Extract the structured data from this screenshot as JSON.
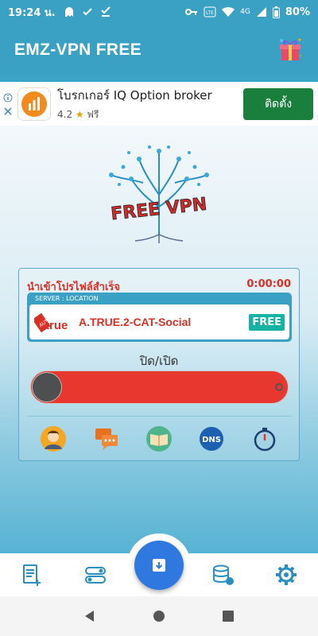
{
  "status_bar": {
    "time": "19:24 น.",
    "battery": "80%",
    "network": "4G"
  },
  "app": {
    "title": "EMZ-VPN FREE"
  },
  "ad": {
    "name": "โบรกเกอร์ IQ Option broker",
    "rating": "4.2",
    "star": "★",
    "price": "ฟรี",
    "install_label": "ติดตั้ง"
  },
  "logo": {
    "text": "FREE VPN"
  },
  "connection": {
    "status": "นำเข้าโปรไฟล์สำเร็จ",
    "timer": "0:00:00",
    "server_label": "SERVER : LOCATION",
    "server_name": "A.TRUE.2-CAT-Social",
    "badge": "FREE",
    "toggle_label": "ปิด/เปิด"
  },
  "colors": {
    "primary": "#3aa1c4",
    "danger": "#e8372e",
    "free_badge": "#14b3a3",
    "install": "#1a7f3c",
    "fab": "#2e78e0"
  },
  "tools": [
    "profile-icon",
    "chat-icon",
    "book-icon",
    "dns-icon",
    "timer-icon"
  ],
  "nav": [
    "document-icon",
    "toggles-icon",
    "import-icon",
    "database-icon",
    "gear-icon"
  ]
}
